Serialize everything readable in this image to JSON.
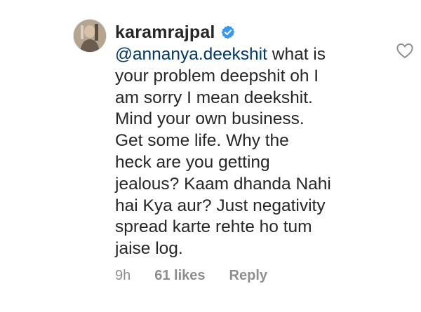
{
  "comment": {
    "username": "karamrajpal",
    "verified": true,
    "mention": "@annanya.deekshit",
    "body_lines": [
      " what is",
      "your problem deepshit oh I",
      "am sorry I mean deekshit.",
      "Mind your own business.",
      "Get some life. Why the",
      "heck are you getting",
      "jealous? Kaam dhanda Nahi",
      "hai Kya aur? Just negativity",
      "spread karte rehte ho tum",
      "jaise log."
    ],
    "time": "9h",
    "likes": "61 likes",
    "reply_label": "Reply"
  },
  "icons": {
    "avatar": "user-avatar",
    "verified": "verified-badge-icon",
    "like": "heart-outline-icon"
  },
  "colors": {
    "text": "#262626",
    "mention": "#00376b",
    "meta": "#8e8e8e",
    "verified": "#3897f0"
  }
}
